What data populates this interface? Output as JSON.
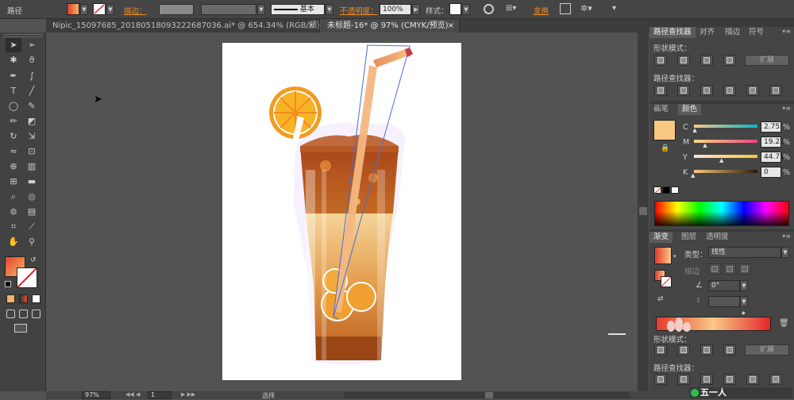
{
  "control_bar": {
    "object_type": "路径",
    "stroke_label": "描边：",
    "stroke_style": "基本",
    "opacity_label": "不透明度：",
    "opacity_value": "100%",
    "style_label": "样式：",
    "transform_label": "变换"
  },
  "tabs": [
    {
      "label": "Nipic_15097685_20180518093222687036.ai* @ 654.34% (RGB/预览)",
      "close": "×"
    },
    {
      "label": "未标题-16* @ 97% (CMYK/预览)",
      "close": "×"
    }
  ],
  "pathfinder_panel": {
    "tabs": [
      "路径查找器",
      "对齐",
      "描边",
      "符号"
    ],
    "shape_modes_label": "形状模式：",
    "expand_button": "扩展",
    "pathfinders_label": "路径查找器："
  },
  "color_panel": {
    "tabs": [
      "画笔",
      "颜色"
    ],
    "channels": [
      {
        "name": "C",
        "value": "2.75",
        "unit": "%",
        "fraction": 0.03
      },
      {
        "name": "M",
        "value": "19.22",
        "unit": "%",
        "fraction": 0.19
      },
      {
        "name": "Y",
        "value": "44.71",
        "unit": "%",
        "fraction": 0.45
      },
      {
        "name": "K",
        "value": "0",
        "unit": "%",
        "fraction": 0.0
      }
    ],
    "swatch_color": "#f7c882"
  },
  "gradient_panel": {
    "tabs": [
      "渐变",
      "图层",
      "透明度"
    ],
    "type_label": "类型：",
    "type_value": "线性",
    "stroke_label": "描边",
    "angle_value": "0°",
    "colors": [
      "#e23c2b",
      "#f9c886",
      "#e3262b"
    ]
  },
  "pathfinder_panel2": {
    "shape_modes_label": "形状模式：",
    "expand_button": "扩展",
    "pathfinders_label": "路径查找器：",
    "watermark": "五一人"
  },
  "status_bar": {
    "zoom": "97%",
    "page": "1",
    "tool_name": "选择"
  },
  "colors": {
    "app_bg": "#535353",
    "panel_bg": "#454545",
    "accent_orange": "#f08a21"
  }
}
